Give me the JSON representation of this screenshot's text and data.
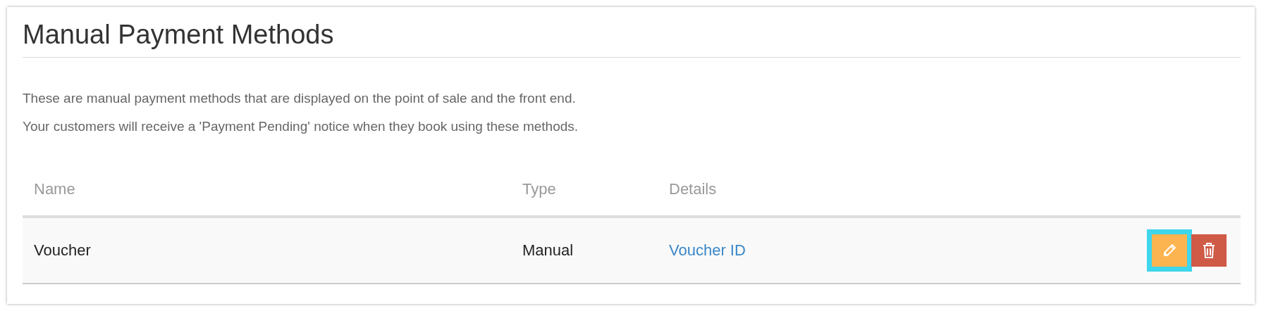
{
  "title": "Manual Payment Methods",
  "description": [
    "These are manual payment methods that are displayed on the point of sale and the front end.",
    "Your customers will receive a 'Payment Pending' notice when they book using these methods."
  ],
  "table": {
    "columns": [
      "Name",
      "Type",
      "Details"
    ],
    "rows": [
      {
        "name": "Voucher",
        "type": "Manual",
        "details": "Voucher ID",
        "actions": [
          {
            "kind": "edit",
            "highlighted": true
          },
          {
            "kind": "delete",
            "highlighted": false
          }
        ]
      }
    ]
  }
}
